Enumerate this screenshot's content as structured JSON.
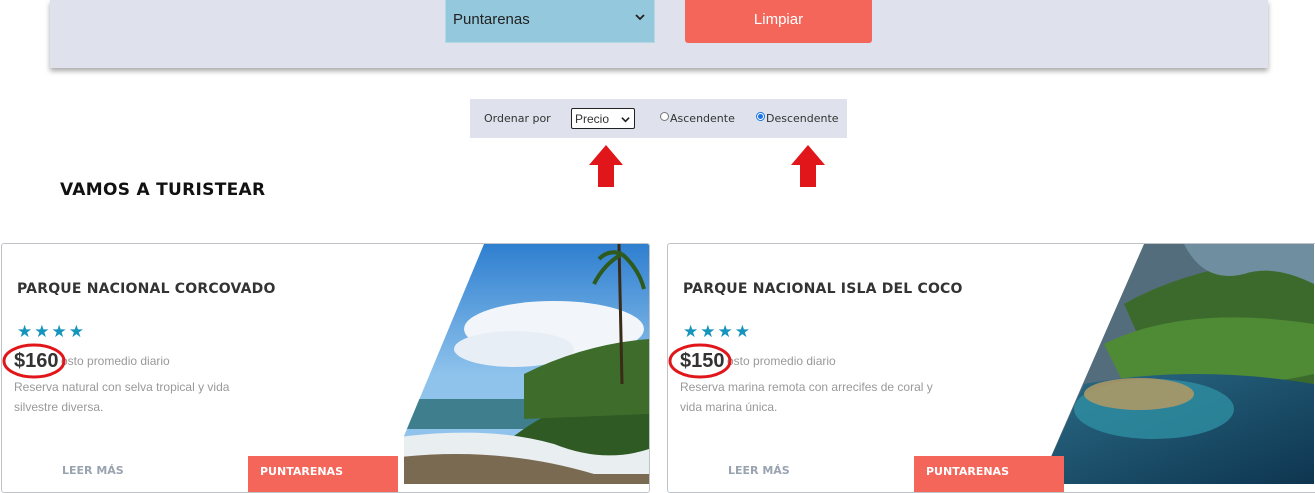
{
  "filters": {
    "region_value": "Puntarenas",
    "clear_label": "Limpiar"
  },
  "sort": {
    "label": "Ordenar por",
    "field_value": "Precio",
    "ascending_label": "Ascendente",
    "descending_label": "Descendente",
    "selected": "Descendente"
  },
  "section_title": "VAMOS A TURISTEAR",
  "cards": [
    {
      "title": "PARQUE NACIONAL CORCOVADO",
      "stars": "★★★★",
      "rating": 4,
      "price": "$160",
      "price_caption": "osto promedio diario",
      "description": "Reserva natural con selva tropical y vida silvestre diversa.",
      "read_more": "LEER MÁS",
      "tag": "PUNTARENAS"
    },
    {
      "title": "PARQUE NACIONAL ISLA DEL COCO",
      "stars": "★★★★",
      "rating": 4,
      "price": "$150",
      "price_caption": "osto promedio diario",
      "description": "Reserva marina remota con arrecifes de coral y vida marina única.",
      "read_more": "LEER MÁS",
      "tag": "PUNTARENAS"
    }
  ],
  "colors": {
    "accent": "#f4655a",
    "panel": "#dfe2ec",
    "select_blue": "#94c9dd",
    "stars": "#1594bc",
    "annotation": "#e0161b"
  }
}
